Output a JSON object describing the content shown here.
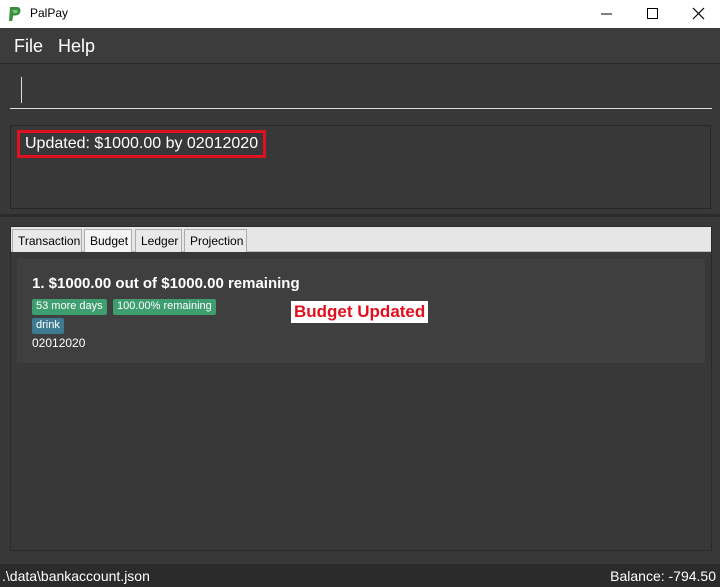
{
  "window": {
    "title": "PalPay",
    "brand_color": "#1a73e8"
  },
  "menu": {
    "file": "File",
    "help": "Help"
  },
  "command": {
    "value": ""
  },
  "result": {
    "text": "Updated: $1000.00 by 02012020"
  },
  "tabs": [
    {
      "label": "Transaction",
      "active": false
    },
    {
      "label": "Budget",
      "active": true
    },
    {
      "label": "Ledger",
      "active": false
    },
    {
      "label": "Projection",
      "active": false
    }
  ],
  "budget": {
    "title": "1.  $1000.00 out of $1000.00 remaining",
    "days_tag": "53 more days",
    "remaining_tag": "100.00% remaining",
    "category_tag": "drink",
    "date": "02012020"
  },
  "overlay": {
    "text": "Budget Updated",
    "color": "#e0101e"
  },
  "status": {
    "path": ".\\data\\bankaccount.json",
    "balance": "Balance: -794.50"
  }
}
